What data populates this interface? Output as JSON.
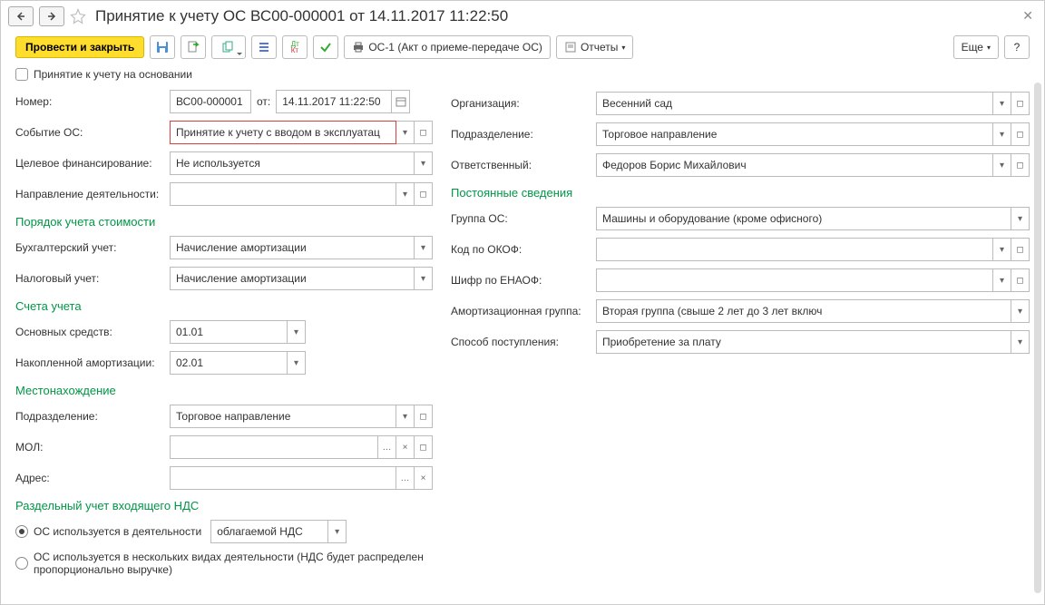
{
  "header": {
    "title": "Принятие к учету ОС ВС00-000001 от 14.11.2017 11:22:50"
  },
  "toolbar": {
    "conduct_close": "Провести и закрыть",
    "print_label": "ОС-1 (Акт о приеме-передаче ОС)",
    "reports": "Отчеты",
    "more": "Еще",
    "help": "?"
  },
  "left": {
    "checkbox_label": "Принятие к учету на основании",
    "number_label": "Номер:",
    "number_value": "ВС00-000001",
    "from_label": "от:",
    "date_value": "14.11.2017 11:22:50",
    "event_label": "Событие ОС:",
    "event_value": "Принятие к учету с вводом в эксплуатац",
    "finance_label": "Целевое финансирование:",
    "finance_value": "Не используется",
    "direction_label": "Направление деятельности:",
    "direction_value": "",
    "section_order": "Порядок учета стоимости",
    "bu_label": "Бухгалтерский учет:",
    "bu_value": "Начисление амортизации",
    "nu_label": "Налоговый учет:",
    "nu_value": "Начисление амортизации",
    "section_accounts": "Счета учета",
    "os_account_label": "Основных средств:",
    "os_account_value": "01.01",
    "amort_account_label": "Накопленной амортизации:",
    "amort_account_value": "02.01",
    "section_location": "Местонахождение",
    "dept_label": "Подразделение:",
    "dept_value": "Торговое направление",
    "mol_label": "МОЛ:",
    "mol_value": "",
    "address_label": "Адрес:",
    "address_value": "",
    "section_vat": "Раздельный учет входящего НДС",
    "radio1_label": "ОС используется в деятельности",
    "radio1_select": "облагаемой НДС",
    "radio2_label": "ОС используется в нескольких видах деятельности (НДС будет распределен пропорционально выручке)"
  },
  "right": {
    "org_label": "Организация:",
    "org_value": "Весенний сад",
    "dept_label": "Подразделение:",
    "dept_value": "Торговое направление",
    "resp_label": "Ответственный:",
    "resp_value": "Федоров Борис Михайлович",
    "section_perm": "Постоянные сведения",
    "group_label": "Группа ОС:",
    "group_value": "Машины и оборудование (кроме офисного)",
    "okof_label": "Код по ОКОФ:",
    "okof_value": "",
    "enaof_label": "Шифр по ЕНАОФ:",
    "enaof_value": "",
    "amort_group_label": "Амортизационная группа:",
    "amort_group_value": "Вторая группа (свыше 2 лет до 3 лет включ",
    "receipt_label": "Способ поступления:",
    "receipt_value": "Приобретение за плату"
  }
}
